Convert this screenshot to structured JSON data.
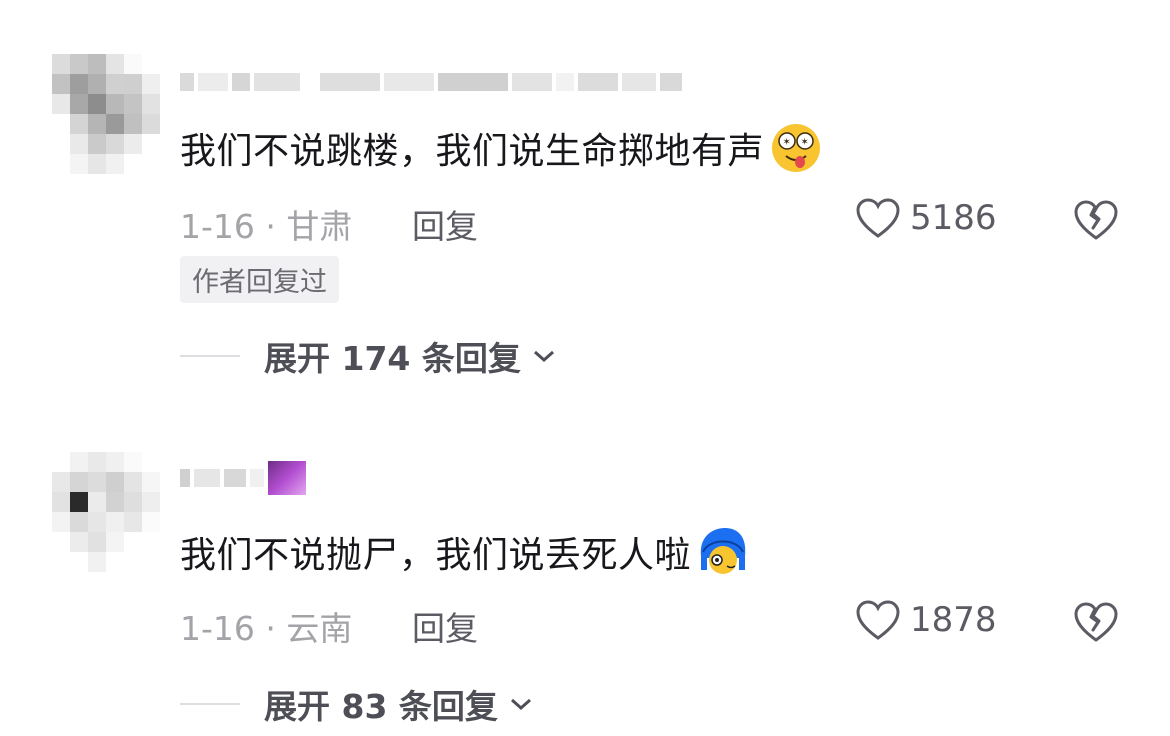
{
  "comments": [
    {
      "text": "我们不说跳楼，我们说生命掷地有声",
      "emoji_icon": "star-eyes-tongue-emoji-icon",
      "meta": "1-16 · 甘肃",
      "reply_label": "回复",
      "likes": "5186",
      "author_badge": "作者回复过",
      "expand_label": "展开 174 条回复"
    },
    {
      "text": "我们不说抛尸，我们说丢死人啦",
      "emoji_icon": "blue-hair-peeking-emoji-icon",
      "meta": "1-16 · 云南",
      "reply_label": "回复",
      "likes": "1878",
      "expand_label": "展开 83 条回复"
    }
  ],
  "colors": {
    "text_primary": "#18181c",
    "text_meta": "#a3a3a8",
    "badge_bg": "#f1f1f3",
    "emoji_yellow": "#f8c531",
    "emoji_blue": "#1b6ff0"
  }
}
